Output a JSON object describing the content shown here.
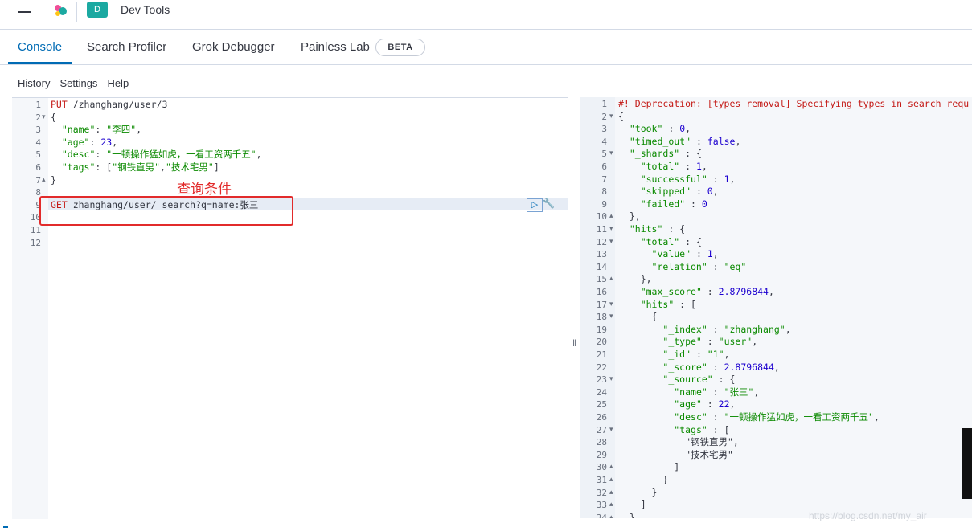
{
  "header": {
    "title": "Dev Tools",
    "app_badge": "D"
  },
  "tabs": [
    {
      "label": "Console",
      "active": true
    },
    {
      "label": "Search Profiler",
      "active": false
    },
    {
      "label": "Grok Debugger",
      "active": false
    },
    {
      "label": "Painless Lab",
      "active": false
    }
  ],
  "beta_badge": "BETA",
  "menu": {
    "history": "History",
    "settings": "Settings",
    "help": "Help"
  },
  "annotation": "查询条件",
  "run_icon": "play-icon",
  "wrench_icon": "wrench-icon",
  "editor": {
    "lines": [
      {
        "n": "1",
        "fold": "",
        "text": "PUT /zhanghang/user/3"
      },
      {
        "n": "2",
        "fold": "▾",
        "text": "{"
      },
      {
        "n": "3",
        "fold": "",
        "text": "  \"name\": \"李四\","
      },
      {
        "n": "4",
        "fold": "",
        "text": "  \"age\": 23,"
      },
      {
        "n": "5",
        "fold": "",
        "text": "  \"desc\": \"一顿操作猛如虎，一看工资两千五\","
      },
      {
        "n": "6",
        "fold": "",
        "text": "  \"tags\": [\"钢铁直男\",\"技术宅男\"]"
      },
      {
        "n": "7",
        "fold": "▴",
        "text": "}"
      },
      {
        "n": "8",
        "fold": "",
        "text": ""
      },
      {
        "n": "9",
        "fold": "",
        "text": "GET zhanghang/user/_search?q=name:张三"
      },
      {
        "n": "10",
        "fold": "",
        "text": ""
      },
      {
        "n": "11",
        "fold": "",
        "text": ""
      },
      {
        "n": "12",
        "fold": "",
        "text": ""
      }
    ]
  },
  "output": {
    "lines": [
      {
        "n": "1",
        "fold": "",
        "text": "#! Deprecation: [types removal] Specifying types in search requ"
      },
      {
        "n": "2",
        "fold": "▾",
        "text": "{"
      },
      {
        "n": "3",
        "fold": "",
        "text": "  \"took\" : 0,"
      },
      {
        "n": "4",
        "fold": "",
        "text": "  \"timed_out\" : false,"
      },
      {
        "n": "5",
        "fold": "▾",
        "text": "  \"_shards\" : {"
      },
      {
        "n": "6",
        "fold": "",
        "text": "    \"total\" : 1,"
      },
      {
        "n": "7",
        "fold": "",
        "text": "    \"successful\" : 1,"
      },
      {
        "n": "8",
        "fold": "",
        "text": "    \"skipped\" : 0,"
      },
      {
        "n": "9",
        "fold": "",
        "text": "    \"failed\" : 0"
      },
      {
        "n": "10",
        "fold": "▴",
        "text": "  },"
      },
      {
        "n": "11",
        "fold": "▾",
        "text": "  \"hits\" : {"
      },
      {
        "n": "12",
        "fold": "▾",
        "text": "    \"total\" : {"
      },
      {
        "n": "13",
        "fold": "",
        "text": "      \"value\" : 1,"
      },
      {
        "n": "14",
        "fold": "",
        "text": "      \"relation\" : \"eq\""
      },
      {
        "n": "15",
        "fold": "▴",
        "text": "    },"
      },
      {
        "n": "16",
        "fold": "",
        "text": "    \"max_score\" : 2.8796844,"
      },
      {
        "n": "17",
        "fold": "▾",
        "text": "    \"hits\" : ["
      },
      {
        "n": "18",
        "fold": "▾",
        "text": "      {"
      },
      {
        "n": "19",
        "fold": "",
        "text": "        \"_index\" : \"zhanghang\","
      },
      {
        "n": "20",
        "fold": "",
        "text": "        \"_type\" : \"user\","
      },
      {
        "n": "21",
        "fold": "",
        "text": "        \"_id\" : \"1\","
      },
      {
        "n": "22",
        "fold": "",
        "text": "        \"_score\" : 2.8796844,"
      },
      {
        "n": "23",
        "fold": "▾",
        "text": "        \"_source\" : {"
      },
      {
        "n": "24",
        "fold": "",
        "text": "          \"name\" : \"张三\","
      },
      {
        "n": "25",
        "fold": "",
        "text": "          \"age\" : 22,"
      },
      {
        "n": "26",
        "fold": "",
        "text": "          \"desc\" : \"一顿操作猛如虎，一看工资两千五\","
      },
      {
        "n": "27",
        "fold": "▾",
        "text": "          \"tags\" : ["
      },
      {
        "n": "28",
        "fold": "",
        "text": "            \"钢铁直男\","
      },
      {
        "n": "29",
        "fold": "",
        "text": "            \"技术宅男\""
      },
      {
        "n": "30",
        "fold": "▴",
        "text": "          ]"
      },
      {
        "n": "31",
        "fold": "▴",
        "text": "        }"
      },
      {
        "n": "32",
        "fold": "▴",
        "text": "      }"
      },
      {
        "n": "33",
        "fold": "▴",
        "text": "    ]"
      },
      {
        "n": "34",
        "fold": "▴",
        "text": "  }"
      }
    ]
  },
  "watermark": "https://blog.csdn.net/my_air",
  "colors": {
    "accent": "#006bb4",
    "annotation": "#e22b2b",
    "string": "#0b8a00"
  }
}
